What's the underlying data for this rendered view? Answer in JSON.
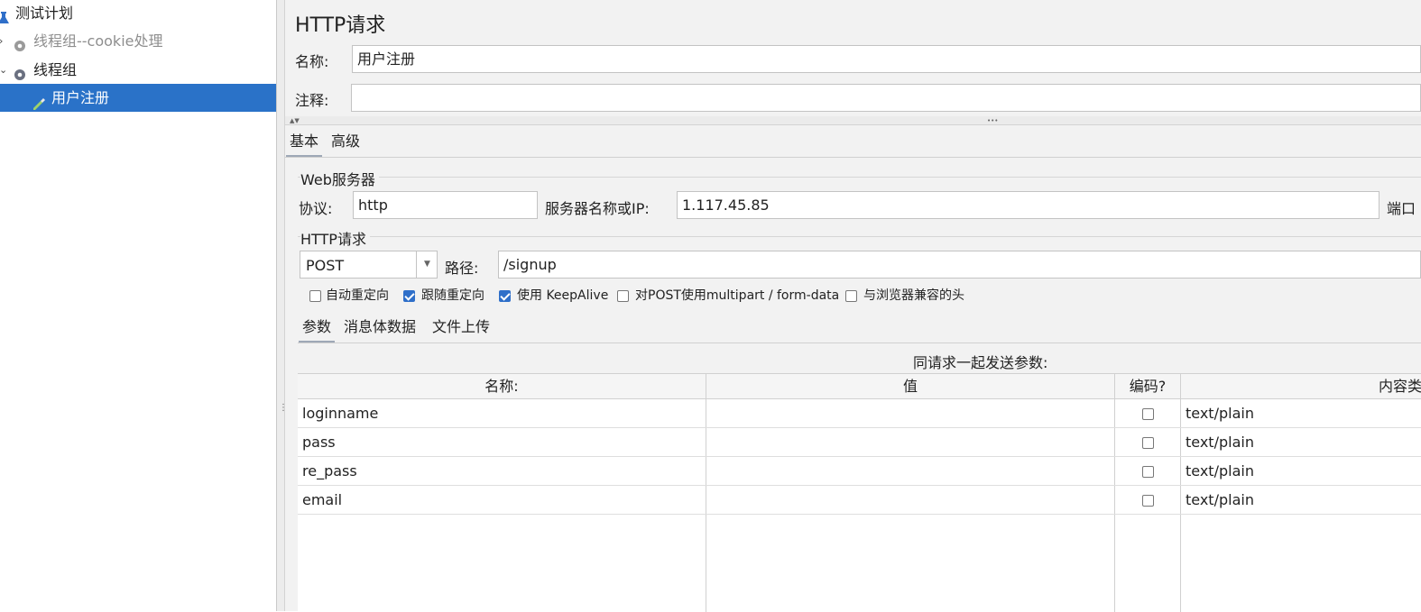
{
  "tree": {
    "items": [
      {
        "label": "测试计划",
        "icon": "flask-icon",
        "arrow": ""
      },
      {
        "label": "线程组--cookie处理",
        "icon": "gear-icon",
        "arrow": "›"
      },
      {
        "label": "线程组",
        "icon": "gear-icon",
        "arrow": "⌄"
      },
      {
        "label": "用户注册",
        "icon": "pipette-icon",
        "arrow": ""
      }
    ]
  },
  "panel": {
    "title": "HTTP请求",
    "name_label": "名称:",
    "name_value": "用户注册",
    "comment_label": "注释:",
    "comment_value": "",
    "collapse_arrows": "▲▼",
    "drag_dots": "•••"
  },
  "tabs": {
    "basic": "基本",
    "advanced": "高级"
  },
  "web_server": {
    "group_title": "Web服务器",
    "protocol_label": "协议:",
    "protocol_value": "http",
    "server_label": "服务器名称或IP:",
    "server_value": "1.117.45.85",
    "port_label": "端口"
  },
  "http_request": {
    "group_title": "HTTP请求",
    "method_value": "POST",
    "dropdown_arrow": "▼",
    "path_label": "路径:",
    "path_value": "/signup"
  },
  "options": [
    {
      "label": "自动重定向",
      "checked": false
    },
    {
      "label": "跟随重定向",
      "checked": true
    },
    {
      "label": "使用 KeepAlive",
      "checked": true
    },
    {
      "label": "对POST使用multipart / form-data",
      "checked": false
    },
    {
      "label": "与浏览器兼容的头",
      "checked": false
    }
  ],
  "subtabs": {
    "params": "参数",
    "body": "消息体数据",
    "files": "文件上传"
  },
  "params_table": {
    "caption": "同请求一起发送参数:",
    "columns": [
      "名称:",
      "值",
      "编码?",
      "内容类型"
    ],
    "rows": [
      {
        "name": "loginname",
        "value": "",
        "encode": false,
        "content_type": "text/plain"
      },
      {
        "name": "pass",
        "value": "",
        "encode": false,
        "content_type": "text/plain"
      },
      {
        "name": "re_pass",
        "value": "",
        "encode": false,
        "content_type": "text/plain"
      },
      {
        "name": "email",
        "value": "",
        "encode": false,
        "content_type": "text/plain"
      }
    ]
  }
}
